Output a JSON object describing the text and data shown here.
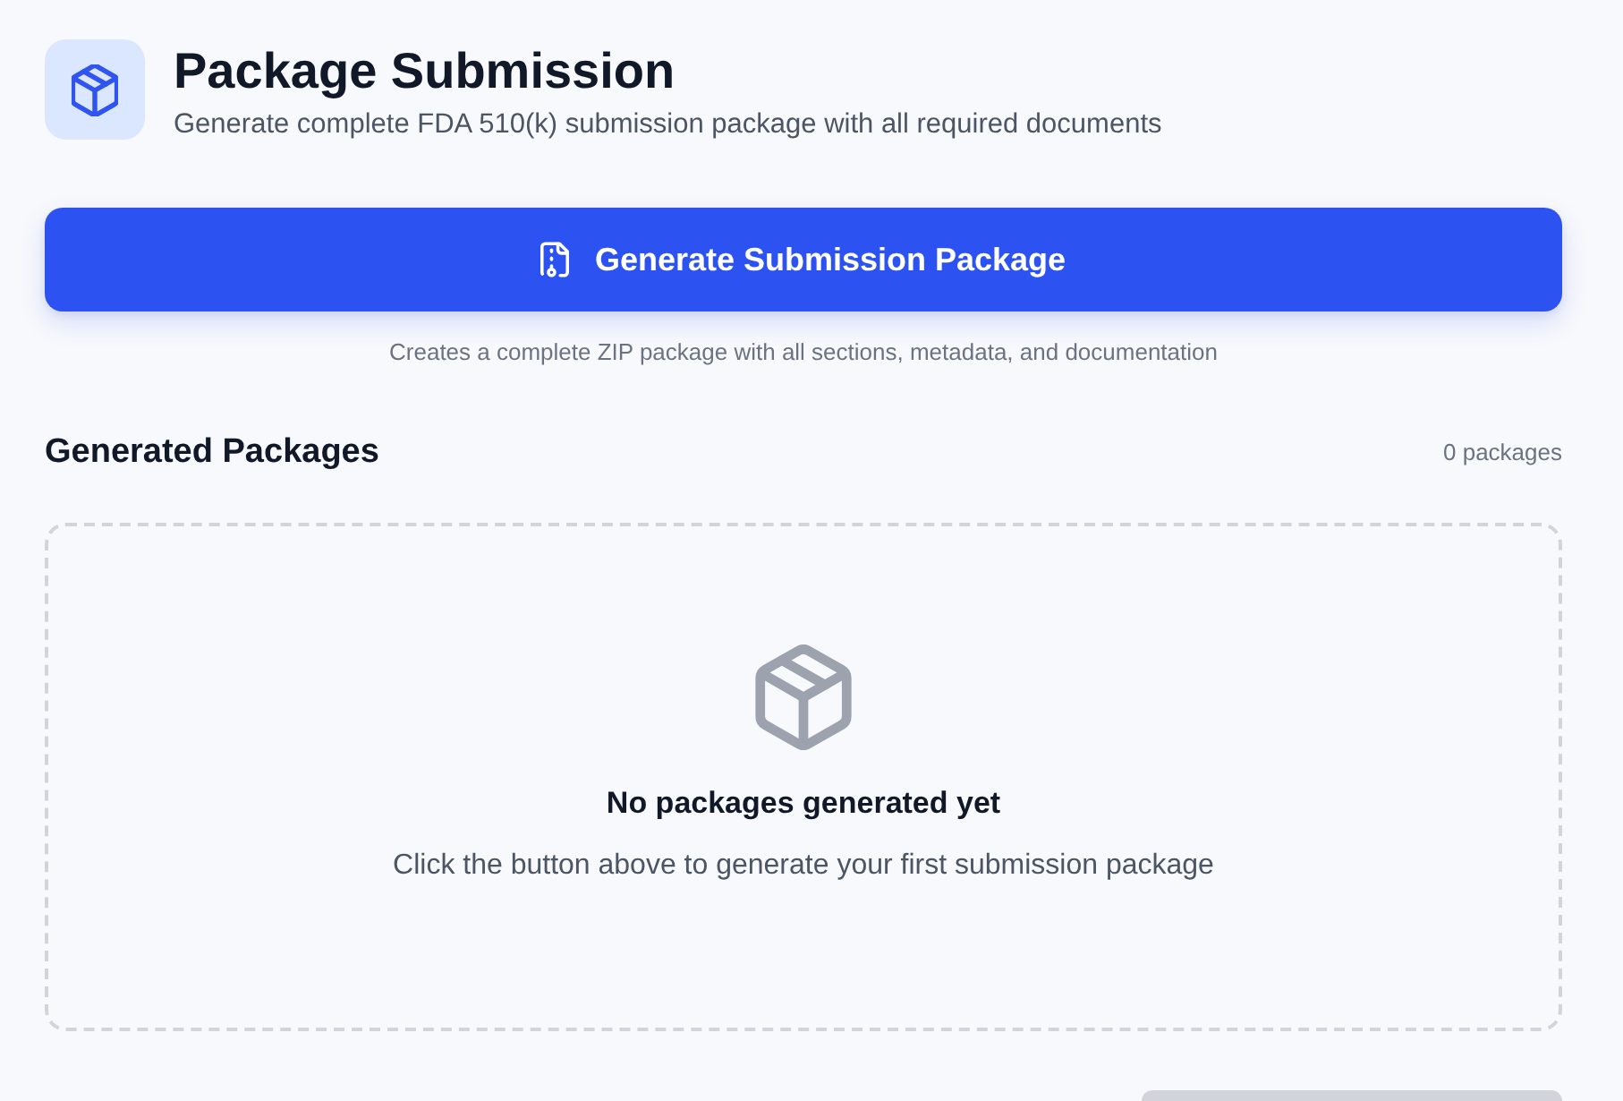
{
  "header": {
    "title": "Package Submission",
    "subtitle": "Generate complete FDA 510(k) submission package with all required documents"
  },
  "generate_button": {
    "label": "Generate Submission Package",
    "caption": "Creates a complete ZIP package with all sections, metadata, and documentation"
  },
  "packages": {
    "title": "Generated Packages",
    "count": "0 packages",
    "empty_state": {
      "title": "No packages generated yet",
      "message": "Click the button above to generate your first submission package"
    }
  }
}
